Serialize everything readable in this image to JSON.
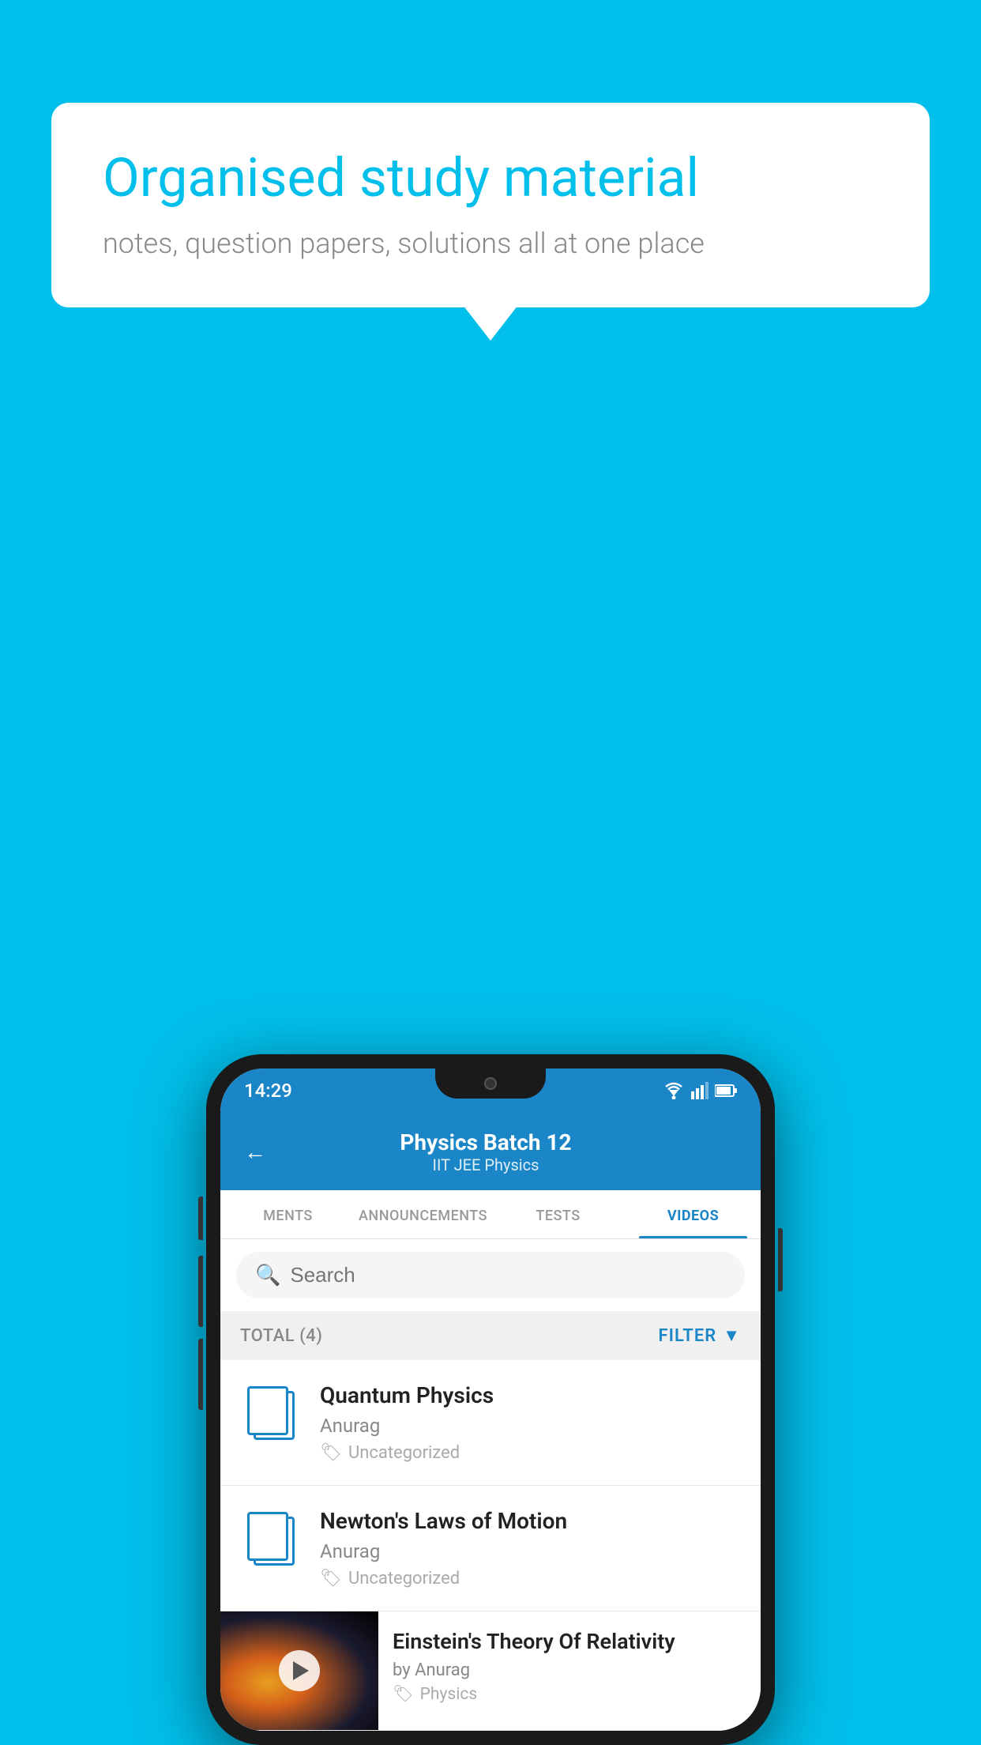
{
  "background": {
    "color": "#00BFEA"
  },
  "bubble": {
    "heading": "Organised study material",
    "subtext": "notes, question papers, solutions all at one place"
  },
  "phone": {
    "statusBar": {
      "time": "14:29"
    },
    "header": {
      "title": "Physics Batch 12",
      "subtitle": "IIT JEE   Physics",
      "backLabel": "←"
    },
    "tabs": [
      {
        "label": "MENTS",
        "active": false
      },
      {
        "label": "ANNOUNCEMENTS",
        "active": false
      },
      {
        "label": "TESTS",
        "active": false
      },
      {
        "label": "VIDEOS",
        "active": true
      }
    ],
    "search": {
      "placeholder": "Search"
    },
    "filterBar": {
      "total": "TOTAL (4)",
      "filterLabel": "FILTER"
    },
    "videos": [
      {
        "title": "Quantum Physics",
        "author": "Anurag",
        "tag": "Uncategorized",
        "hasThumb": false
      },
      {
        "title": "Newton's Laws of Motion",
        "author": "Anurag",
        "tag": "Uncategorized",
        "hasThumb": false
      },
      {
        "title": "Einstein's Theory Of Relativity",
        "author": "by Anurag",
        "tag": "Physics",
        "hasThumb": true
      }
    ]
  }
}
